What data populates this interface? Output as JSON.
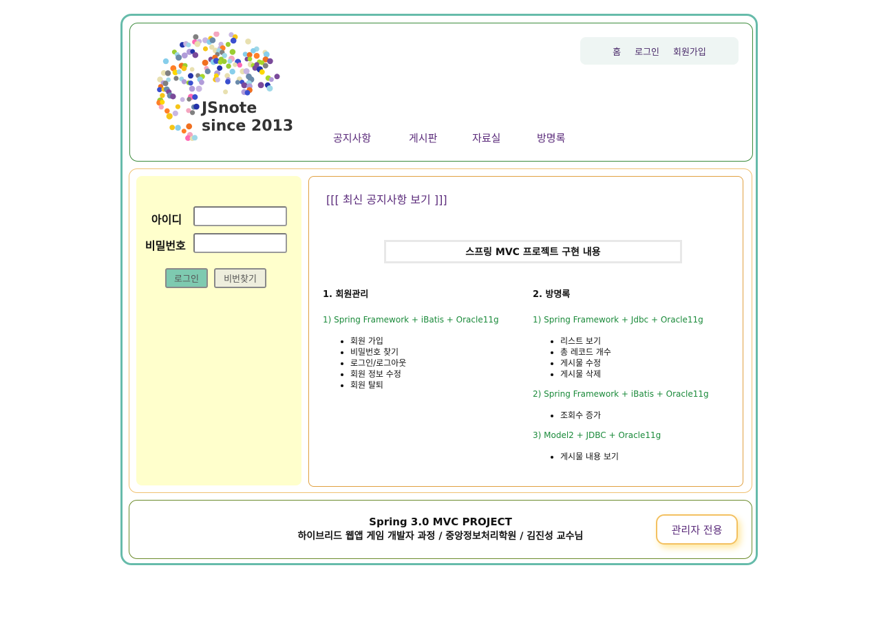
{
  "header": {
    "logo_line1": "JSnote",
    "logo_line2": "since 2013",
    "top_menu": [
      "홈",
      "로그인",
      "회원가입"
    ],
    "main_nav": [
      "공지사항",
      "게시판",
      "자료실",
      "방명록"
    ]
  },
  "login": {
    "id_label": "아이디",
    "pw_label": "비밀번호",
    "id_value": "",
    "pw_value": "",
    "login_button": "로그인",
    "find_pw_button": "비번찾기",
    "login_button_color": "#7ecab0",
    "find_pw_button_color": "#eeeedd"
  },
  "notice": {
    "title": "[[[ 최신 공지사항 보기 ]]]",
    "project_title": "스프링 MVC 프로젝트 구현 내용",
    "left_column": {
      "heading": "1. 회원관리",
      "groups": [
        {
          "subtitle": "1) Spring Framework + iBatis + Oracle11g",
          "items": [
            "회원 가입",
            "비밀번호 찾기",
            "로그인/로그아웃",
            "회원 정보 수정",
            "회원 탈퇴"
          ]
        }
      ]
    },
    "right_column": {
      "heading": "2. 방명록",
      "groups": [
        {
          "subtitle": "1) Spring Framework + Jdbc + Oracle11g",
          "items": [
            "리스트 보기",
            "총 레코드 개수",
            "게시물 수정",
            "게시물 삭제"
          ]
        },
        {
          "subtitle": "2) Spring Framework + iBatis + Oracle11g",
          "items": [
            "조회수 증가"
          ]
        },
        {
          "subtitle": "3) Model2 + JDBC + Oracle11g",
          "items": [
            "게시물 내용 보기"
          ]
        }
      ]
    }
  },
  "footer": {
    "line1": "Spring 3.0 MVC PROJECT",
    "line2": "하이브리드 웹앱 게임 개발자 과정 / 중앙정보처리학원 / 김진성 교수님",
    "admin_button": "관리자 전용"
  }
}
